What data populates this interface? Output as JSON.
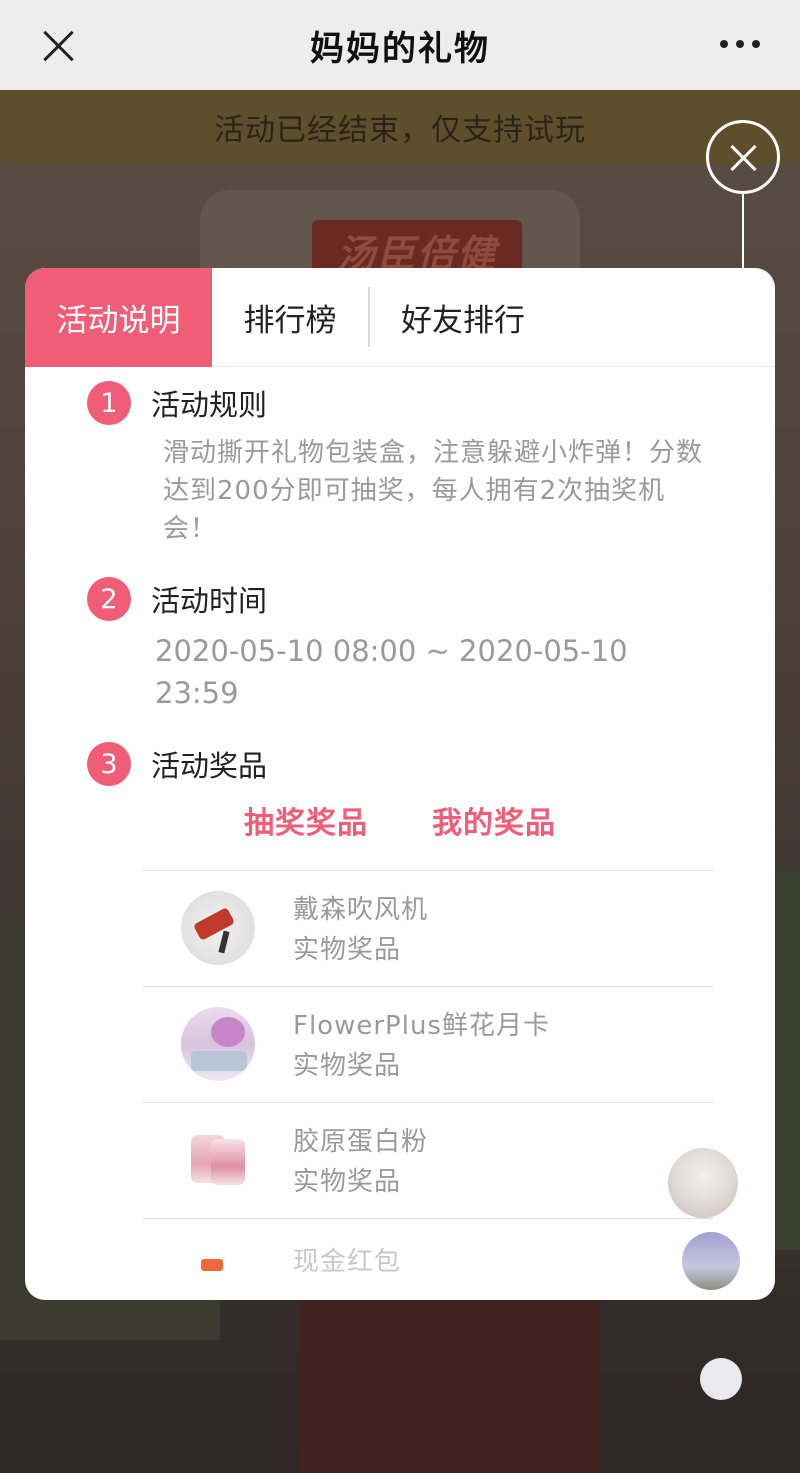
{
  "topbar": {
    "title": "妈妈的礼物",
    "close_icon": "close-icon",
    "more_icon": "more-dots-icon"
  },
  "background": {
    "notice": "活动已经结束，仅支持试玩",
    "brand": "汤臣倍健"
  },
  "modal": {
    "tabs": [
      {
        "label": "活动说明",
        "active": true
      },
      {
        "label": "排行榜",
        "active": false
      },
      {
        "label": "好友排行",
        "active": false
      }
    ],
    "sections": [
      {
        "num": "1",
        "title": "活动规则",
        "body": "滑动撕开礼物包装盒，注意躲避小炸弹！分数达到200分即可抽奖，每人拥有2次抽奖机会！"
      },
      {
        "num": "2",
        "title": "活动时间",
        "body": "2020-05-10 08:00 ~ 2020-05-10 23:59"
      },
      {
        "num": "3",
        "title": "活动奖品"
      }
    ],
    "prize_tabs": [
      "抽奖奖品",
      "我的奖品"
    ],
    "prizes": [
      {
        "name": "戴森吹风机",
        "type": "实物奖品",
        "icon": "hair-dryer-image"
      },
      {
        "name": "FlowerPlus鲜花月卡",
        "type": "实物奖品",
        "icon": "flower-image"
      },
      {
        "name": "胶原蛋白粉",
        "type": "实物奖品",
        "icon": "collagen-powder-image"
      },
      {
        "name": "现金红包",
        "type": "",
        "icon": "red-packet-image"
      }
    ]
  },
  "colors": {
    "accent": "#ef5d77",
    "topbar_bg": "#ededed",
    "muted_text": "#9a9a9a"
  }
}
